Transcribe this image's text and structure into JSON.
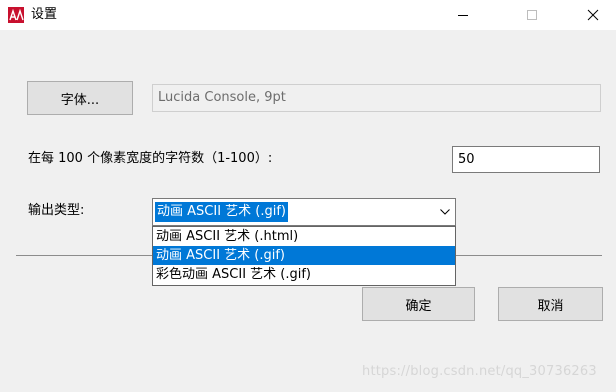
{
  "window": {
    "title": "设置",
    "controls": {
      "minimize": "minimize-icon",
      "maximize": "maximize-icon",
      "close": "close-icon"
    }
  },
  "font": {
    "button_label": "字体...",
    "current_value": "Lucida Console, 9pt"
  },
  "chars_per_100": {
    "label": "在每 100 个像素宽度的字符数（1-100）:",
    "value": "50"
  },
  "output_type": {
    "label": "输出类型:",
    "selected": "动画 ASCII 艺术 (.gif)",
    "options": [
      "动画 ASCII 艺术 (.html)",
      "动画 ASCII 艺术 (.gif)",
      "彩色动画 ASCII 艺术 (.gif)"
    ],
    "selected_index": 1
  },
  "actions": {
    "ok_label": "确定",
    "cancel_label": "取消"
  },
  "watermark": "https://blog.csdn.net/qq_30736263",
  "colors": {
    "selection": "#0078d7",
    "dialog_bg": "#f0f0f0",
    "button_bg": "#e1e1e1",
    "app_icon": "#c8102e"
  }
}
